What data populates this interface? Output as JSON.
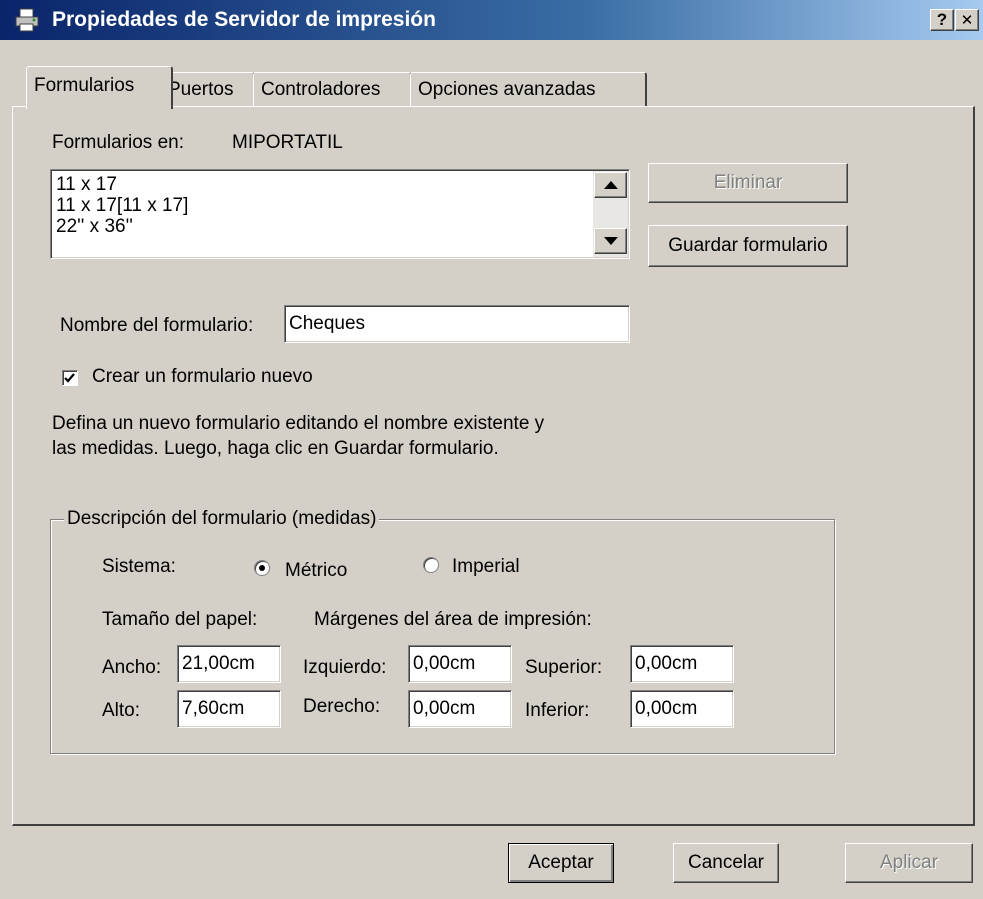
{
  "window": {
    "title": "Propiedades de Servidor de impresión",
    "help_button": "?",
    "close_button": "✕",
    "title_bar_color": "#0a246a"
  },
  "tabs": [
    {
      "label": "Formularios",
      "active": true
    },
    {
      "label": "Puertos",
      "active": false
    },
    {
      "label": "Controladores",
      "active": false
    },
    {
      "label": "Opciones avanzadas",
      "active": false
    }
  ],
  "forms_tab": {
    "forms_on_label": "Formularios en:",
    "server_name": "MIPORTATIL",
    "forms_list": [
      "11 x 17",
      "11 x 17[11 x 17]",
      "22'' x 36''"
    ],
    "delete_button": "Eliminar",
    "save_button": "Guardar formulario",
    "form_name_label": "Nombre del formulario:",
    "form_name_value": "Cheques",
    "create_new_label": "Crear un formulario nuevo",
    "create_new_checked": true,
    "help_text_line1": "Defina un nuevo formulario editando el nombre existente y",
    "help_text_line2": "las medidas. Luego, haga clic en Guardar formulario.",
    "description_group": {
      "title": "Descripción del formulario (medidas)",
      "system_label": "Sistema:",
      "metric_label": "Métrico",
      "imperial_label": "Imperial",
      "selected_system": "metric",
      "paper_size_label": "Tamaño del papel:",
      "margins_label": "Márgenes del área de impresión:",
      "width_label": "Ancho:",
      "width_value": "21,00cm",
      "height_label": "Alto:",
      "height_value": "7,60cm",
      "left_label": "Izquierdo:",
      "left_value": "0,00cm",
      "right_label": "Derecho:",
      "right_value": "0,00cm",
      "top_label": "Superior:",
      "top_value": "0,00cm",
      "bottom_label": "Inferior:",
      "bottom_value": "0,00cm"
    }
  },
  "footer": {
    "ok_button": "Aceptar",
    "cancel_button": "Cancelar",
    "apply_button": "Aplicar"
  }
}
